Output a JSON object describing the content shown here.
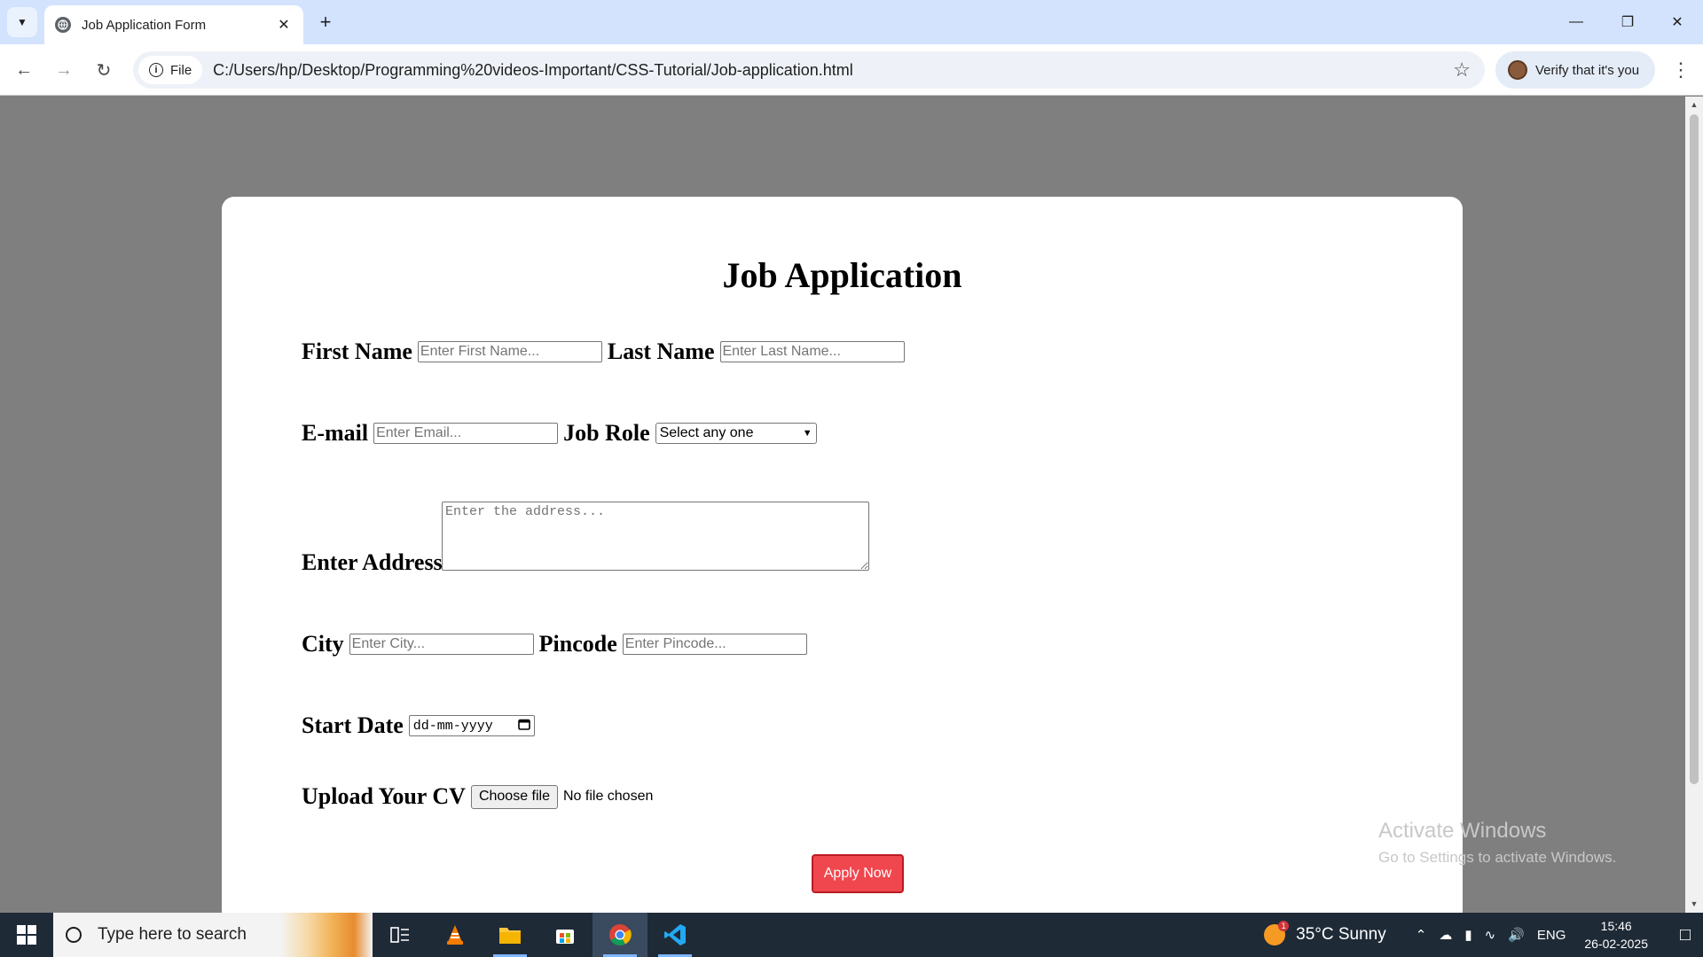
{
  "browser": {
    "tab_title": "Job Application Form",
    "url_chip": "File",
    "url": "C:/Users/hp/Desktop/Programming%20videos-Important/CSS-Tutorial/Job-application.html",
    "verify_label": "Verify that it's you"
  },
  "form": {
    "title": "Job Application",
    "first_name_label": "First Name",
    "first_name_placeholder": "Enter First Name...",
    "last_name_label": "Last Name",
    "last_name_placeholder": "Enter Last Name...",
    "email_label": "E-mail",
    "email_placeholder": "Enter Email...",
    "job_role_label": "Job Role",
    "job_role_selected": "Select any one",
    "address_label": "Enter Address",
    "address_placeholder": "Enter the address...",
    "city_label": "City",
    "city_placeholder": "Enter City...",
    "pincode_label": "Pincode",
    "pincode_placeholder": "Enter Pincode...",
    "start_date_label": "Start Date",
    "start_date_value": "dd-mm-yyyy",
    "cv_label": "Upload Your CV",
    "file_button": "Choose file",
    "file_status": "No file chosen",
    "apply_label": "Apply Now",
    "apply_color": "#f0474f"
  },
  "watermark": {
    "line1": "Activate Windows",
    "line2": "Go to Settings to activate Windows."
  },
  "taskbar": {
    "search_placeholder": "Type here to search",
    "weather": "35°C  Sunny",
    "weather_badge": "1",
    "language": "ENG",
    "time": "15:46",
    "date": "26-02-2025"
  }
}
